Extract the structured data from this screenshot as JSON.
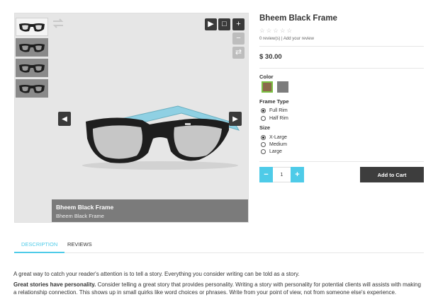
{
  "gallery": {
    "caption_title": "Bheem Black Frame",
    "caption_subtitle": "Bheem Black Frame",
    "controls": {
      "play": "▶",
      "fullscreen": "□",
      "zoom_in": "+",
      "zoom_out": "−",
      "reset": "⇄"
    },
    "prev": "◀",
    "next": "▶"
  },
  "product": {
    "title": "Bheem Black Frame",
    "stars": [
      "☆",
      "☆",
      "☆",
      "☆",
      "☆"
    ],
    "reviews": "0 review(s)",
    "separator": "|",
    "add_review": "Add your review",
    "price": "$ 30.00",
    "color_label": "Color",
    "colors": [
      "#8b6a4a",
      "#7d7d7d"
    ],
    "frame_type_label": "Frame Type",
    "frame_types": [
      "Full Rim",
      "Half Rim"
    ],
    "size_label": "Size",
    "sizes": [
      "X-Large",
      "Medium",
      "Large"
    ],
    "qty_minus": "−",
    "qty_value": "1",
    "qty_plus": "+",
    "add_to_cart": "Add to Cart"
  },
  "tabs": [
    {
      "label": "DESCRIPTION",
      "active": true
    },
    {
      "label": "REVIEWS",
      "active": false
    }
  ],
  "description": {
    "para1": "A great way to catch your reader's attention is to tell a story. Everything you consider writing can be told as a story.",
    "para2_bold": "Great stories have personality.",
    "para2_rest": " Consider telling a great story that provides personality. Writing a story with personality for potential clients will assists with making a relationship connection. This shows up in small quirks like word choices or phrases. Write from your point of view, not from someone else's experience."
  },
  "colors": {
    "accent": "#4ecbe8",
    "dark": "#3d3d3d",
    "frame_blue": "#8fd0e3",
    "frame_black": "#1e1e1e"
  }
}
